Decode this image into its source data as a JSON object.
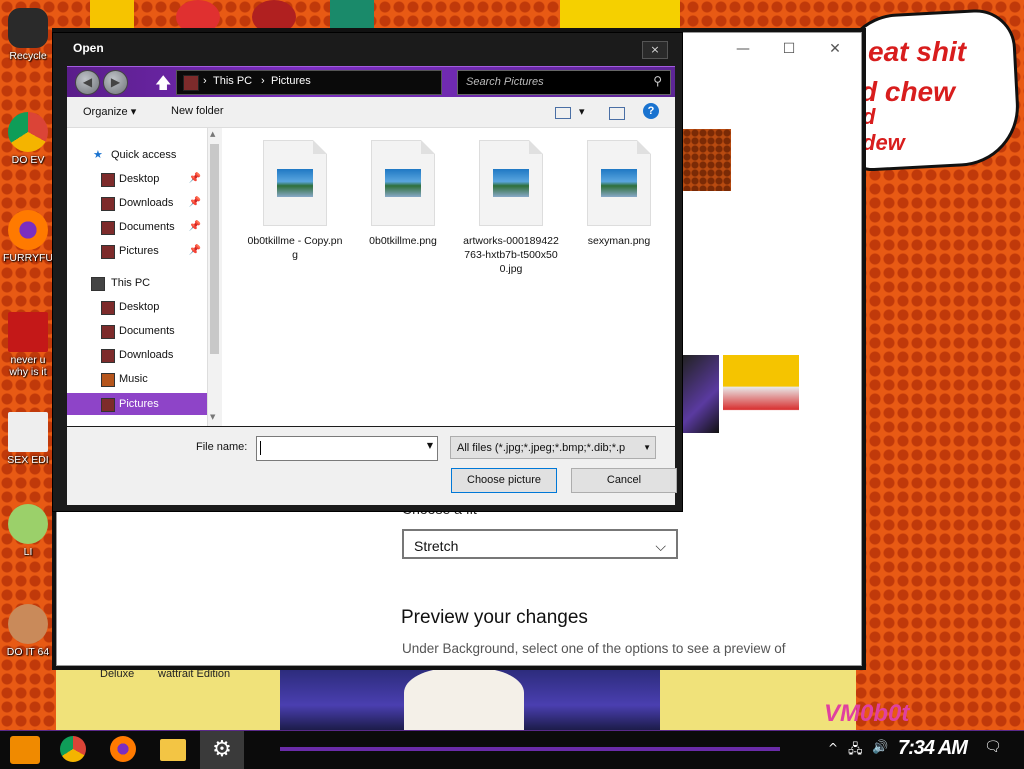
{
  "desktop": {
    "icons": [
      {
        "label": "Recycle"
      },
      {
        "label": "DO EV"
      },
      {
        "label": "FURRYFU"
      },
      {
        "label": "never u\nwhy is it"
      },
      {
        "label": "SEX EDI"
      },
      {
        "label": "LI"
      },
      {
        "label": "DO IT 64"
      }
    ],
    "bottom_labels": [
      "Deluxe",
      "wattrait Edition"
    ],
    "speech_bubble": [
      "eat shit",
      "d chew",
      "d",
      "dew"
    ],
    "watermark": "VM0b0t"
  },
  "settings_window": {
    "fit_label": "Choose a fit",
    "fit_value": "Stretch",
    "preview_heading": "Preview your changes",
    "preview_text": "Under Background, select one of the options to see a preview of"
  },
  "dialog": {
    "title": "Open",
    "close_glyph": "×",
    "breadcrumb": [
      "This PC",
      "Pictures"
    ],
    "search_placeholder": "Search Pictures",
    "toolbar": {
      "organize": "Organize",
      "new_folder": "New folder"
    },
    "nav": {
      "quick_access": "Quick access",
      "quick_items": [
        "Desktop",
        "Downloads",
        "Documents",
        "Pictures"
      ],
      "this_pc": "This PC",
      "pc_items": [
        "Desktop",
        "Documents",
        "Downloads",
        "Music",
        "Pictures"
      ]
    },
    "files": [
      {
        "name": "0b0tkillme - Copy.png"
      },
      {
        "name": "0b0tkillme.png"
      },
      {
        "name": "artworks-000189422763-hxtb7b-t500x500.jpg"
      },
      {
        "name": "sexyman.png"
      }
    ],
    "file_name_label": "File name:",
    "file_name_value": "",
    "filter_value": "All files (*.jpg;*.jpeg;*.bmp;*.dib;*.p",
    "choose_button": "Choose picture",
    "cancel_button": "Cancel"
  },
  "taskbar": {
    "clock": "7:34 AM"
  },
  "colors": {
    "accent_purple": "#7b2ec0",
    "desktop_orange": "#e85a14",
    "selection": "#8e44c8"
  }
}
